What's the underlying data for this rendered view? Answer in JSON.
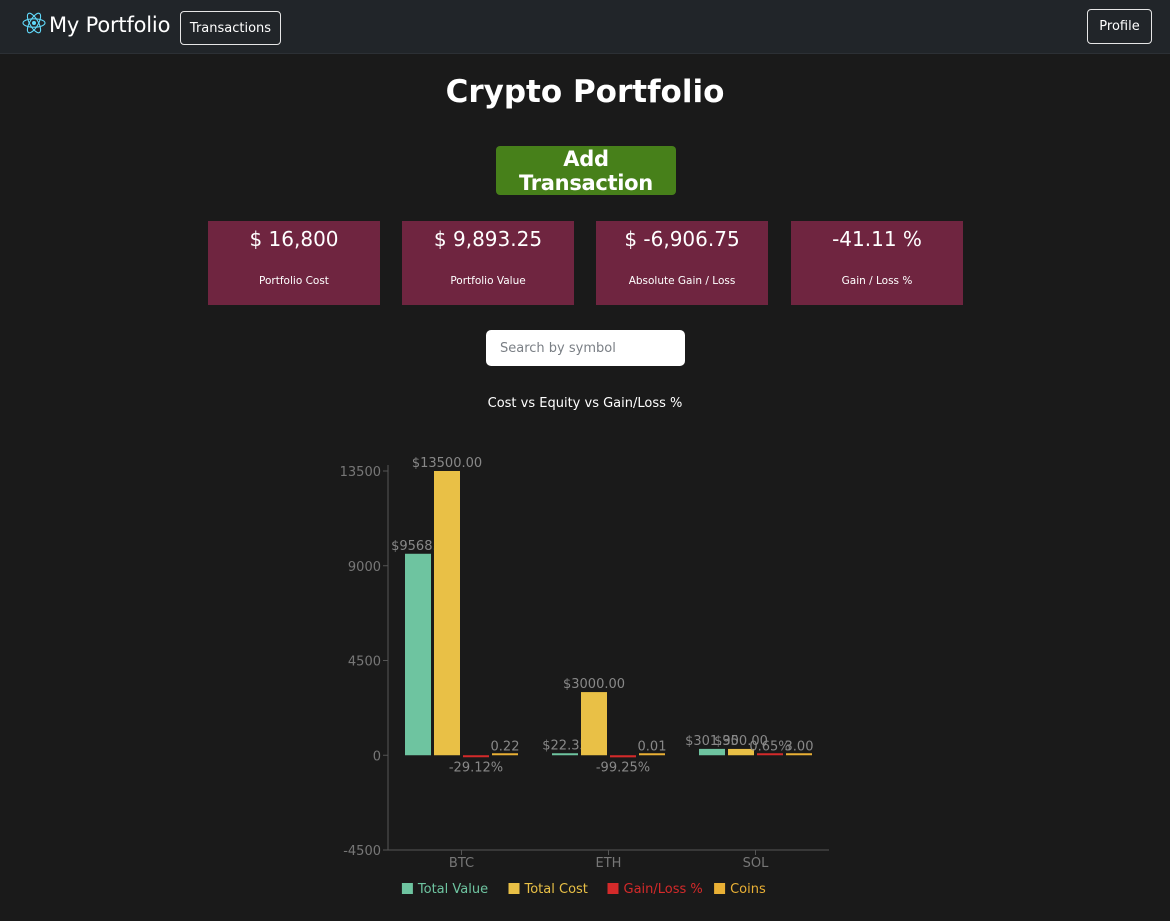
{
  "navbar": {
    "brand_icon": "react-atom-icon",
    "brand": "My Portfolio",
    "transactions_label": "Transactions",
    "profile_label": "Profile"
  },
  "page": {
    "title": "Crypto Portfolio",
    "add_transaction_label": "Add Transaction"
  },
  "summary_cards": [
    {
      "value": "$ 16,800",
      "label": "Portfolio Cost"
    },
    {
      "value": "$ 9,893.25",
      "label": "Portfolio Value"
    },
    {
      "value": "$ -6,906.75",
      "label": "Absolute Gain / Loss"
    },
    {
      "value": "-41.11 %",
      "label": "Gain / Loss %"
    }
  ],
  "search": {
    "placeholder": "Search by symbol",
    "value": ""
  },
  "colors": {
    "card_bg": "#6f2540",
    "add_button": "#47801a",
    "total_value": "#6ec4a0",
    "total_cost": "#e9c046",
    "gain_loss": "#d42a2a",
    "coins": "#e9b035"
  },
  "chart_data": {
    "type": "bar",
    "title": "Cost vs Equity vs Gain/Loss %",
    "categories": [
      "BTC",
      "ETH",
      "SOL"
    ],
    "ylim": [
      -4500,
      13500
    ],
    "yticks": [
      13500,
      9000,
      4500,
      0,
      -4500
    ],
    "legend_position": "bottom",
    "series": [
      {
        "name": "Total Value",
        "values": [
          9568.9,
          22.35,
          301.95
        ],
        "labels": [
          "$9568.9",
          "$22.35",
          "$301.95"
        ]
      },
      {
        "name": "Total Cost",
        "values": [
          13500,
          3000,
          300
        ],
        "labels": [
          "$13500.00",
          "$3000.00",
          "$300.00"
        ]
      },
      {
        "name": "Gain/Loss %",
        "values": [
          -29.12,
          -99.25,
          0.65
        ],
        "labels": [
          "-29.12%",
          "-99.25%",
          "0.65%"
        ]
      },
      {
        "name": "Coins",
        "values": [
          0.22,
          0.01,
          3.0
        ],
        "labels": [
          "0.22",
          "0.01",
          "3.00"
        ]
      }
    ]
  }
}
